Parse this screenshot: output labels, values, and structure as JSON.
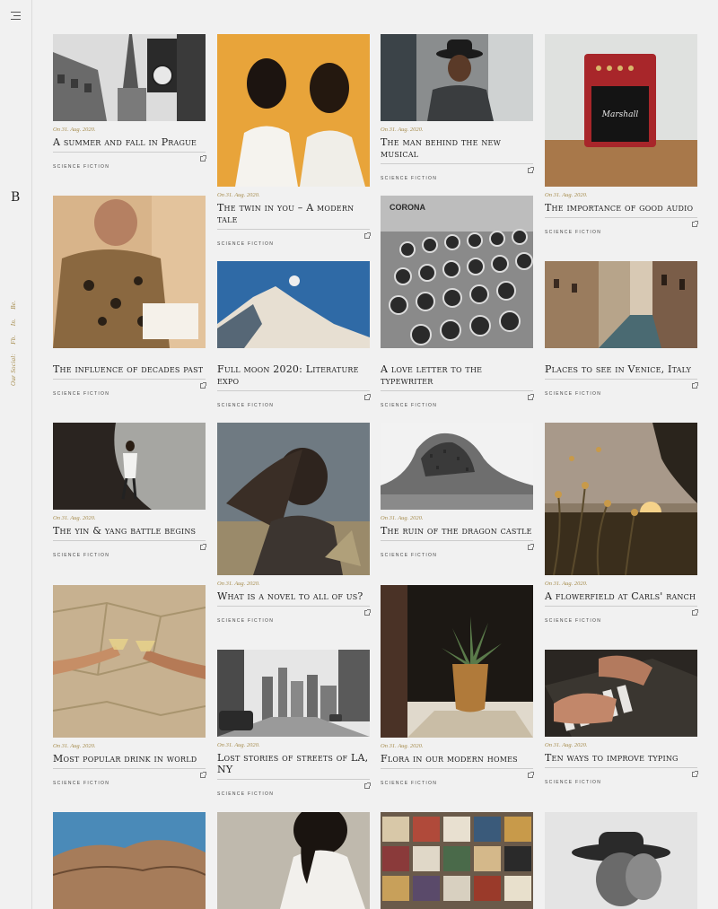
{
  "sidebar": {
    "logo": "B",
    "social_label": "Our Social:",
    "social_links": [
      "Fb.",
      "In.",
      "Be."
    ]
  },
  "posts": [
    {
      "date": "On 31. Aug. 2020.",
      "title": "A summer and fall in Prague",
      "category": "Science Fiction"
    },
    {
      "date": "On 31. Aug. 2020.",
      "title": "The man behind the new musical",
      "category": "Science Fiction"
    },
    {
      "date": "On 31. Aug. 2020.",
      "title": "The twin in you – A modern tale",
      "category": "Science Fiction"
    },
    {
      "date": "On 31. Aug. 2020.",
      "title": "The importance of good audio",
      "category": "Science Fiction"
    },
    {
      "date": "",
      "title": "The influence of decades past",
      "category": "Science Fiction"
    },
    {
      "date": "",
      "title": "Full moon 2020: Literature expo",
      "category": "Science Fiction"
    },
    {
      "date": "",
      "title": "A love letter to the typewriter",
      "category": "Science Fiction"
    },
    {
      "date": "",
      "title": "Places to see in Venice, Italy",
      "category": "Science Fiction"
    },
    {
      "date": "On 31. Aug. 2020.",
      "title": "The yin & yang battle begins",
      "category": "Science Fiction"
    },
    {
      "date": "On 31. Aug. 2020.",
      "title": "The ruin of the dragon castle",
      "category": "Science Fiction"
    },
    {
      "date": "On 31. Aug. 2020.",
      "title": "What is a novel to all of us?",
      "category": "Science Fiction"
    },
    {
      "date": "On 31. Aug. 2020.",
      "title": "A flowerfield at Carls' ranch",
      "category": "Science Fiction"
    },
    {
      "date": "On 31. Aug. 2020.",
      "title": "Most popular drink in world",
      "category": "Science Fiction"
    },
    {
      "date": "On 31. Aug. 2020.",
      "title": "Lost stories of streets of LA, NY",
      "category": "Science Fiction"
    },
    {
      "date": "On 31. Aug. 2020.",
      "title": "Flora in our modern homes",
      "category": "Science Fiction"
    },
    {
      "date": "On 31. Aug. 2020.",
      "title": "Ten ways to improve typing",
      "category": "Science Fiction"
    }
  ]
}
